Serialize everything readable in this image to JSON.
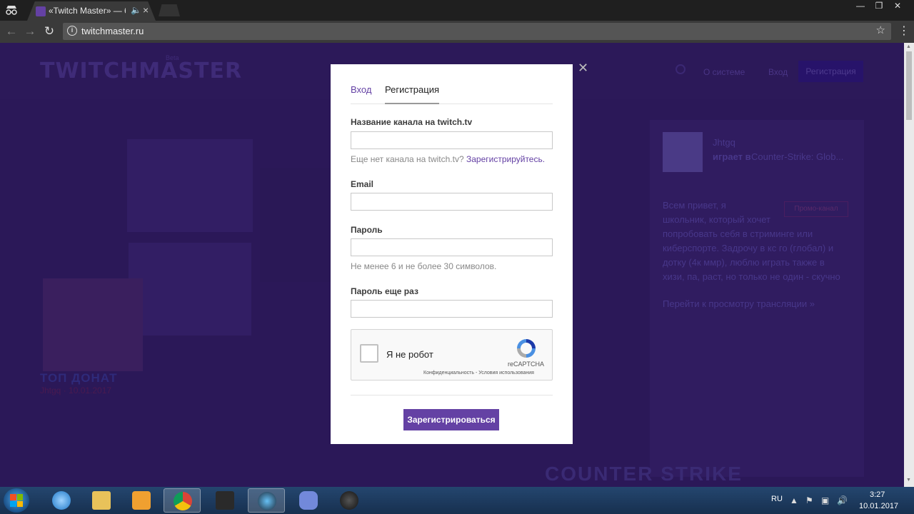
{
  "browser": {
    "tab_title": "«Twitch Master» — бе",
    "url": "twitchmaster.ru",
    "window_buttons": [
      "—",
      "❐",
      "✕"
    ]
  },
  "site": {
    "logo": "TWITCHMASTER",
    "logo_badge": "Beta",
    "nav": [
      "О системе",
      "Вход"
    ],
    "register_button": "Регистрация",
    "background_profile": {
      "name": "Jhtgq",
      "plays_prefix": "играет в",
      "game": "Counter-Strike: Glob...",
      "promo_badge": "Промо-канал",
      "description_lines": [
        "Всем привет, я",
        "школьник, который хочет",
        "попробовать себя в стриминге или",
        "киберспорте. Задрочу в кс го (глобал) и",
        "дотку (4к ммр), люблю играть также в",
        "хизи, па, раст, но только не один - скучно"
      ],
      "watch_link": "Перейти к просмотру трансляции »",
      "top_donat": "ТОП ДОНАТ",
      "top_donat_sub": "Jhtgq · 10.01.2017"
    },
    "background_banner": "COUNTER STRIKE"
  },
  "modal": {
    "tabs": [
      "Вход",
      "Регистрация"
    ],
    "active_tab": "Регистрация",
    "fields": [
      {
        "label": "Название канала на twitch.tv",
        "value": "",
        "hint": "Еще нет канала на twitch.tv?",
        "hint_link": "Зарегистрируйтесь."
      },
      {
        "label": "Email",
        "value": "",
        "hint": "",
        "hint_link": ""
      },
      {
        "label": "Пароль",
        "value": "",
        "hint": "Не менее 6 и не более 30 символов.",
        "hint_link": ""
      },
      {
        "label": "Пароль еще раз",
        "value": "",
        "hint": "",
        "hint_link": ""
      }
    ],
    "recaptcha": {
      "label": "Я не робот",
      "brand": "reCAPTCHA",
      "links": "Конфиденциальность - Условия использования",
      "checked": false
    },
    "submit_label": "Зарегистрироваться"
  },
  "taskbar": {
    "apps": [
      "internet-explorer",
      "file-explorer",
      "media-player",
      "chrome",
      "game-app",
      "steam",
      "discord",
      "obs"
    ],
    "active_app": "chrome",
    "language": "RU",
    "time": "3:27",
    "date": "10.01.2017"
  },
  "colors": {
    "accent": "#6441a4",
    "page_overlay": "#2e1a5c",
    "taskbar": "#1c3a5e"
  }
}
